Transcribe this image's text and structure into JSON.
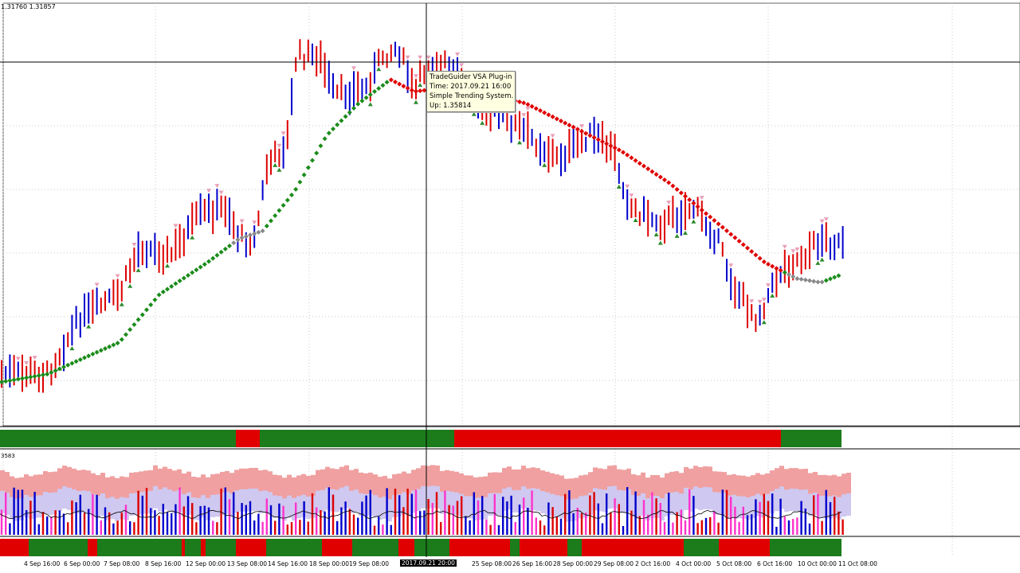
{
  "main_chart": {
    "header_text": "1.31760 1.31857",
    "tooltip": {
      "lines": [
        "TradeGuider VSA Plug-in",
        "Time: 2017.09.21 16:00",
        "Simple Trending System.",
        "Up: 1.35814"
      ]
    }
  },
  "sub_window": {
    "header_text": "3583"
  },
  "time_axis": {
    "labels": [
      "4 Sep 16:00",
      "6 Sep 00:00",
      "7 Sep 08:00",
      "8 Sep 16:00",
      "12 Sep 00:00",
      "13 Sep 08:00",
      "14 Sep 16:00",
      "18 Sep 00:00",
      "19 Sep 08:00",
      "25 Sep 08:00",
      "26 Sep 16:00",
      "28 Sep 00:00",
      "29 Sep 08:00",
      "2 Oct 16:00",
      "4 Oct 00:00",
      "5 Oct 08:00",
      "6 Oct 16:00",
      "10 Oct 00:00",
      "11 Oct 08:00"
    ],
    "crosshair_label": "2017.09.21 20:00"
  },
  "colors": {
    "up_bar": "#0000cc",
    "down_bar": "#dd0000",
    "trend_up": "#1a8c1a",
    "trend_down": "#e00000",
    "trend_neutral": "#888888",
    "strip_green": "#1c7c1c",
    "strip_red": "#e00000"
  }
}
